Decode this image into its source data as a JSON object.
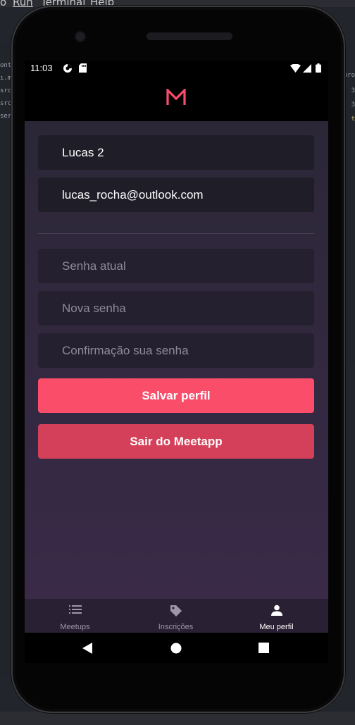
{
  "ide": {
    "menu": [
      "o",
      "Run",
      "Terminal",
      "Help"
    ],
    "left_snips": [
      "ont",
      "ı.m",
      "src/",
      "src/",
      "ser"
    ],
    "right_snips": [
      ".pro",
      "3",
      "3",
      "t"
    ]
  },
  "status_bar": {
    "time": "11:03"
  },
  "app": {
    "logo": "M"
  },
  "profile": {
    "name": "Lucas 2",
    "email": "lucas_rocha@outlook.com",
    "current_password_placeholder": "Senha atual",
    "new_password_placeholder": "Nova senha",
    "confirm_password_placeholder": "Confirmação sua senha",
    "save_label": "Salvar perfil",
    "logout_label": "Sair do Meetapp"
  },
  "tabs": [
    {
      "label": "Meetups",
      "icon": "list-icon",
      "active": false
    },
    {
      "label": "Inscrições",
      "icon": "tag-icon",
      "active": false
    },
    {
      "label": "Meu perfil",
      "icon": "person-icon",
      "active": true
    }
  ],
  "colors": {
    "primary": "#f94d6a",
    "logout": "#d44059",
    "background_top": "#2b2737",
    "background_bottom": "#3a2a48"
  }
}
